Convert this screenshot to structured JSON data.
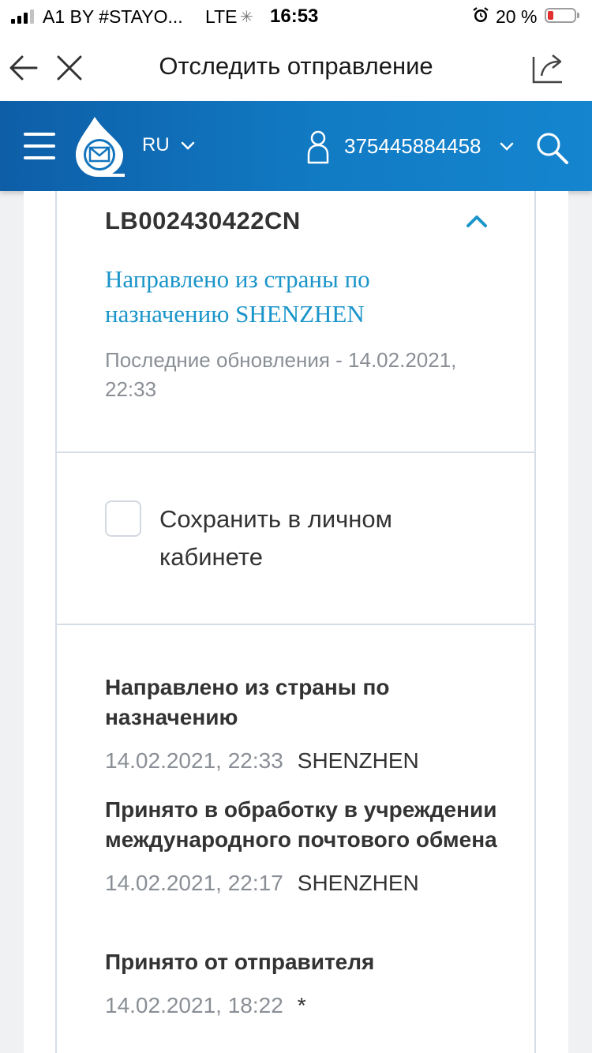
{
  "status_bar": {
    "carrier": "A1 BY #STAYO...",
    "network": "LTE",
    "time": "16:53",
    "battery_percent": "20 %",
    "battery_level": 0.2,
    "signal_bars": 3
  },
  "nav": {
    "title": "Отследить отправление"
  },
  "header": {
    "language": "RU",
    "phone": "375445884458",
    "brand_color": "#0d5ea7"
  },
  "tracking": {
    "number": "LB002430422CN",
    "status": "Направлено из страны по назначению SHENZHEN",
    "last_update": "Последние обновления - 14.02.2021, 22:33",
    "status_color": "#1b95c9"
  },
  "save": {
    "label": "Сохранить в личном кабинете",
    "checked": false
  },
  "events": [
    {
      "title": "Направлено из страны по назначению",
      "date": "14.02.2021, 22:33",
      "place": "SHENZHEN"
    },
    {
      "title": "Принято в обработку в учреждении международного почтового обмена",
      "date": "14.02.2021, 22:17",
      "place": "SHENZHEN"
    },
    {
      "title": "Принято от отправителя",
      "date": "14.02.2021, 18:22",
      "place": "*"
    }
  ]
}
